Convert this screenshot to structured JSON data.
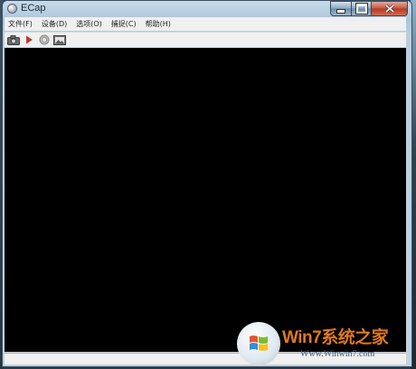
{
  "window": {
    "title": "ECap"
  },
  "menubar": {
    "items": [
      {
        "label": "文件(F)"
      },
      {
        "label": "设备(D)"
      },
      {
        "label": "选项(O)"
      },
      {
        "label": "捕捉(C)"
      },
      {
        "label": "帮助(H)"
      }
    ]
  },
  "toolbar": {
    "buttons": [
      {
        "icon": "camera-icon"
      },
      {
        "icon": "play-icon"
      },
      {
        "icon": "stop-icon"
      },
      {
        "icon": "image-icon"
      }
    ]
  },
  "colors": {
    "viewport_bg": "#000000",
    "play": "#c0392b",
    "close_button": "#c6533c",
    "watermark_brand": "#e0781e"
  },
  "watermark": {
    "brand": "Win7系统之家",
    "url": "Www.Winwin7.com"
  }
}
